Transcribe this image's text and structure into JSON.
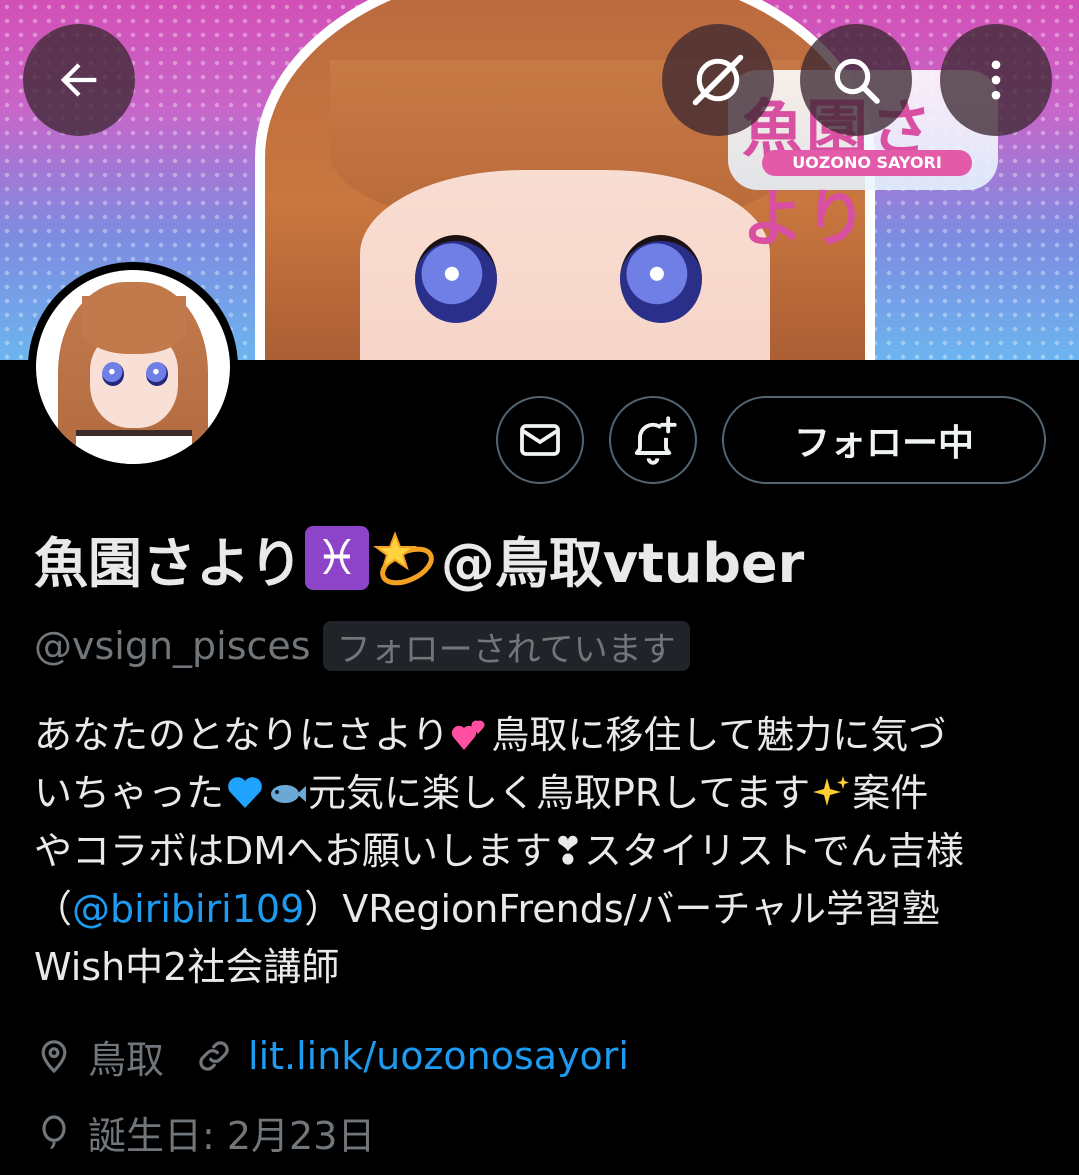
{
  "banner": {
    "logo_text": "魚園さより",
    "logo_subtext": "UOZONO SAYORI"
  },
  "nav": {
    "back_icon": "arrow-left-icon",
    "grok_icon": "grok-icon",
    "search_icon": "search-icon",
    "more_icon": "more-vertical-icon"
  },
  "actions": {
    "message_icon": "mail-icon",
    "notify_icon": "bell-plus-icon",
    "following_label": "フォロー中"
  },
  "profile": {
    "name_part1": "魚園さより",
    "name_emoji1": "♓",
    "name_part2": "@鳥取vtuber",
    "handle": "@vsign_pisces",
    "follows_you": "フォローされています"
  },
  "bio": {
    "line1_a": "あなたのとなりにさより",
    "line1_b": "鳥取に移住して魅力に気づ",
    "line2_a": "いちゃった",
    "line2_b": "元気に楽しく鳥取PRしてます",
    "line2_c": "案件",
    "line3": "やコラボはDMへお願いします❣スタイリストでん吉様",
    "line4_open": "（",
    "line4_mention": "@biribiri109",
    "line4_rest": "）VRegionFrends/バーチャル学習塾",
    "line5": "Wish中2社会講師"
  },
  "meta": {
    "location_icon": "location-pin-icon",
    "location": "鳥取",
    "link_icon": "link-icon",
    "link": "lit.link/uozonosayori",
    "birthday_icon": "balloon-icon",
    "birthday": "誕生日: 2月23日"
  },
  "colors": {
    "background": "#000000",
    "text": "#e7e9ea",
    "secondary": "#71767b",
    "link": "#1d9bf0",
    "border": "#536471"
  }
}
